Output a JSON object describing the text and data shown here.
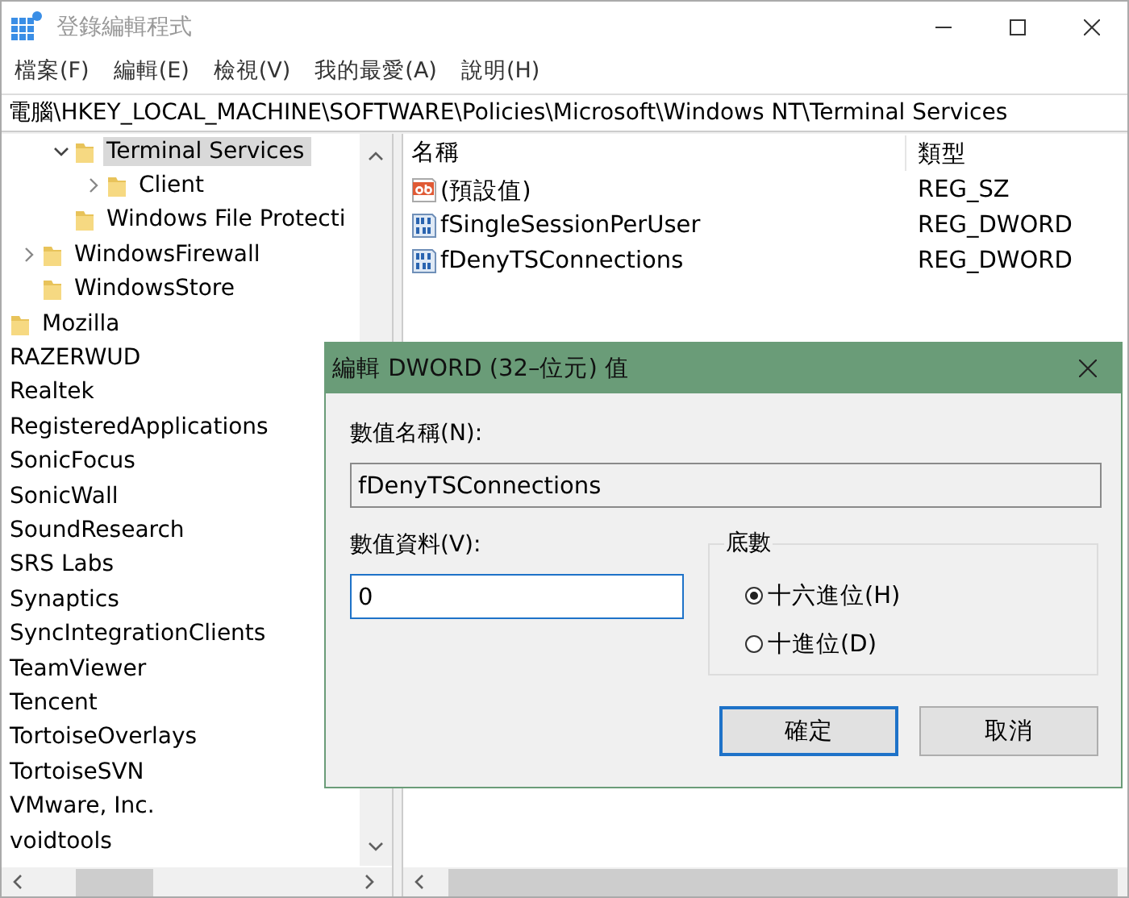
{
  "window": {
    "title": "登錄編輯程式"
  },
  "menu": [
    "檔案(F)",
    "編輯(E)",
    "檢視(V)",
    "我的最愛(A)",
    "說明(H)"
  ],
  "address": "電腦\\HKEY_LOCAL_MACHINE\\SOFTWARE\\Policies\\Microsoft\\Windows NT\\Terminal Services",
  "tree": [
    {
      "children": [
        {
          "children": [
            {
              "children": [
                {
                  "label": "Terminal Services",
                  "expanded": true,
                  "selected": true,
                  "children": [
                    {
                      "label": "Client",
                      "expanded": false,
                      "selected": false
                    }
                  ]
                },
                {
                  "label": "Windows File Protecti",
                  "selected": false
                }
              ]
            },
            {
              "label": "WindowsFirewall",
              "expanded": false,
              "selected": false
            },
            {
              "label": "WindowsStore",
              "selected": false
            }
          ]
        },
        {
          "label": "Mozilla",
          "selected": false
        }
      ]
    },
    {
      "label": "RAZERWUD",
      "selected": false
    },
    {
      "label": "Realtek",
      "selected": false
    },
    {
      "label": "RegisteredApplications",
      "selected": false
    },
    {
      "label": "SonicFocus",
      "selected": false
    },
    {
      "label": "SonicWall",
      "selected": false
    },
    {
      "label": "SoundResearch",
      "selected": false
    },
    {
      "label": "SRS Labs",
      "selected": false
    },
    {
      "label": "Synaptics",
      "selected": false
    },
    {
      "label": "SyncIntegrationClients",
      "selected": false
    },
    {
      "label": "TeamViewer",
      "selected": false
    },
    {
      "label": "Tencent",
      "selected": false
    },
    {
      "label": "TortoiseOverlays",
      "selected": false
    },
    {
      "label": "TortoiseSVN",
      "selected": false
    },
    {
      "label": "VMware, Inc.",
      "selected": false
    },
    {
      "label": "voidtools",
      "selected": false
    }
  ],
  "values": {
    "columns": [
      "名稱",
      "類型"
    ],
    "rows": [
      {
        "kind": "string",
        "name": "(預設值)",
        "type": "REG_SZ"
      },
      {
        "kind": "dword",
        "name": "fSingleSessionPerUser",
        "type": "REG_DWORD"
      },
      {
        "kind": "dword",
        "name": "fDenyTSConnections",
        "type": "REG_DWORD"
      }
    ]
  },
  "dialog": {
    "title": "編輯 DWORD (32–位元) 值",
    "name_label": "數值名稱(N):",
    "name_value": "fDenyTSConnections",
    "data_label": "數值資料(V):",
    "data_value": "0",
    "base_title": "底數",
    "bases": [
      {
        "label": "十六進位(H)",
        "selected": true
      },
      {
        "label": "十進位(D)",
        "selected": false
      }
    ],
    "buttons": [
      {
        "label": "確定",
        "default": true
      },
      {
        "label": "取消",
        "default": false
      }
    ]
  }
}
